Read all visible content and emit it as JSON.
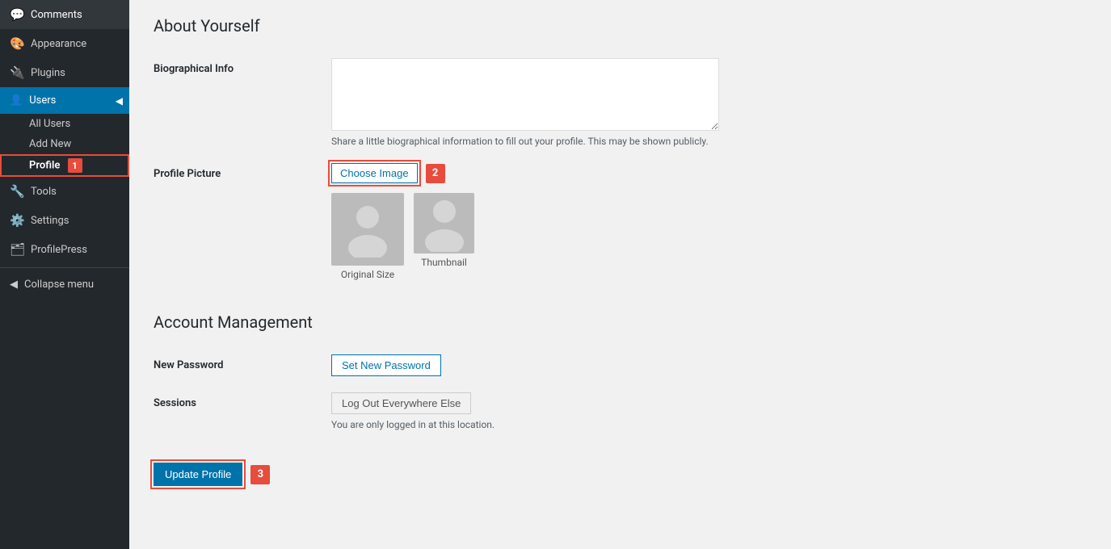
{
  "sidebar": {
    "items": [
      {
        "id": "comments",
        "label": "Comments",
        "icon": "💬",
        "active": false
      },
      {
        "id": "appearance",
        "label": "Appearance",
        "icon": "🎨",
        "active": false
      },
      {
        "id": "plugins",
        "label": "Plugins",
        "icon": "🔌",
        "active": false
      },
      {
        "id": "users",
        "label": "Users",
        "icon": "👤",
        "active": true
      },
      {
        "id": "tools",
        "label": "Tools",
        "icon": "🔧",
        "active": false
      },
      {
        "id": "settings",
        "label": "Settings",
        "icon": "⚙️",
        "active": false
      },
      {
        "id": "profilepress",
        "label": "ProfilePress",
        "icon": "🗂",
        "active": false
      }
    ],
    "sub_items": [
      {
        "id": "all-users",
        "label": "All Users"
      },
      {
        "id": "add-new",
        "label": "Add New"
      },
      {
        "id": "profile",
        "label": "Profile",
        "active": true
      }
    ],
    "collapse_label": "Collapse menu"
  },
  "main": {
    "about_section_title": "About Yourself",
    "bio_label": "Biographical Info",
    "bio_placeholder": "",
    "bio_desc": "Share a little biographical information to fill out your profile. This may be shown publicly.",
    "profile_picture_label": "Profile Picture",
    "choose_image_label": "Choose Image",
    "avatar_original_label": "Original Size",
    "avatar_thumbnail_label": "Thumbnail",
    "account_section_title": "Account Management",
    "new_password_label": "New Password",
    "set_password_label": "Set New Password",
    "sessions_label": "Sessions",
    "logout_label": "Log Out Everywhere Else",
    "session_note": "You are only logged in at this location.",
    "update_profile_label": "Update Profile"
  },
  "badges": {
    "badge1": "1",
    "badge2": "2",
    "badge3": "3"
  }
}
